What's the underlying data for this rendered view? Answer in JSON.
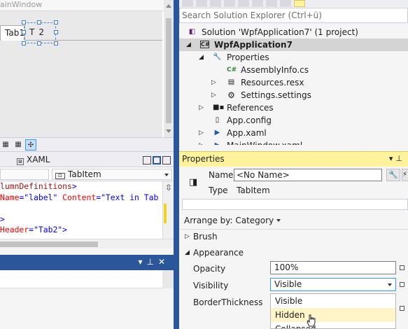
{
  "designer": {
    "window_title": "ainWindow",
    "tabs": [
      "Tab1",
      "T",
      "2"
    ]
  },
  "xaml_pane": {
    "tab_label": "XAML",
    "element_selector": "TabItem",
    "code_lines": [
      [
        {
          "t": "lumnDefinitions",
          "k": "tag"
        },
        {
          "t": ">",
          "k": "pun"
        }
      ],
      [
        {
          "t": "Name",
          "k": "attr"
        },
        {
          "t": "=\"label\" ",
          "k": "val"
        },
        {
          "t": "Content",
          "k": "attr"
        },
        {
          "t": "=\"Text in Tab",
          "k": "val"
        }
      ],
      [
        {
          "t": "",
          "k": "val"
        }
      ],
      [
        {
          "t": ">",
          "k": "pun"
        }
      ],
      [
        {
          "t": "Header",
          "k": "attr"
        },
        {
          "t": "=\"Tab2\"",
          "k": "val"
        },
        {
          "t": ">",
          "k": "pun"
        }
      ]
    ]
  },
  "solution_explorer": {
    "search_placeholder": "Search Solution Explorer (Ctrl+ü)",
    "items": [
      {
        "label": "Solution 'WpfApplication7' (1 project)",
        "icon": "solution-icon"
      },
      {
        "label": "WpfApplication7",
        "icon": "csharp-project-icon"
      },
      {
        "label": "Properties",
        "icon": "wrench-icon"
      },
      {
        "label": "AssemblyInfo.cs",
        "icon": "csharp-file-icon"
      },
      {
        "label": "Resources.resx",
        "icon": "resource-file-icon"
      },
      {
        "label": "Settings.settings",
        "icon": "settings-gear-icon"
      },
      {
        "label": "References",
        "icon": "references-icon"
      },
      {
        "label": "App.config",
        "icon": "config-file-icon"
      },
      {
        "label": "App.xaml",
        "icon": "xaml-file-icon"
      },
      {
        "label": "MainWindow.xaml",
        "icon": "xaml-file-icon"
      }
    ]
  },
  "properties": {
    "title": "Properties",
    "name_label": "Name",
    "name_value": "<No Name>",
    "type_label": "Type",
    "type_value": "TabItem",
    "arrange_by": "Arrange by: Category",
    "categories": {
      "brush": "Brush",
      "appearance": "Appearance"
    },
    "props": {
      "opacity": {
        "label": "Opacity",
        "value": "100%"
      },
      "visibility": {
        "label": "Visibility",
        "value": "Visible"
      },
      "border_thickness": {
        "label": "BorderThickness"
      }
    },
    "visibility_options": [
      "Visible",
      "Hidden",
      "Collapsed"
    ],
    "hovered_option": "Hidden"
  },
  "colors": {
    "accent": "#2b579a",
    "active_title": "#fff29d",
    "selection": "#cce8ff",
    "hover_item": "#fff5c9"
  }
}
